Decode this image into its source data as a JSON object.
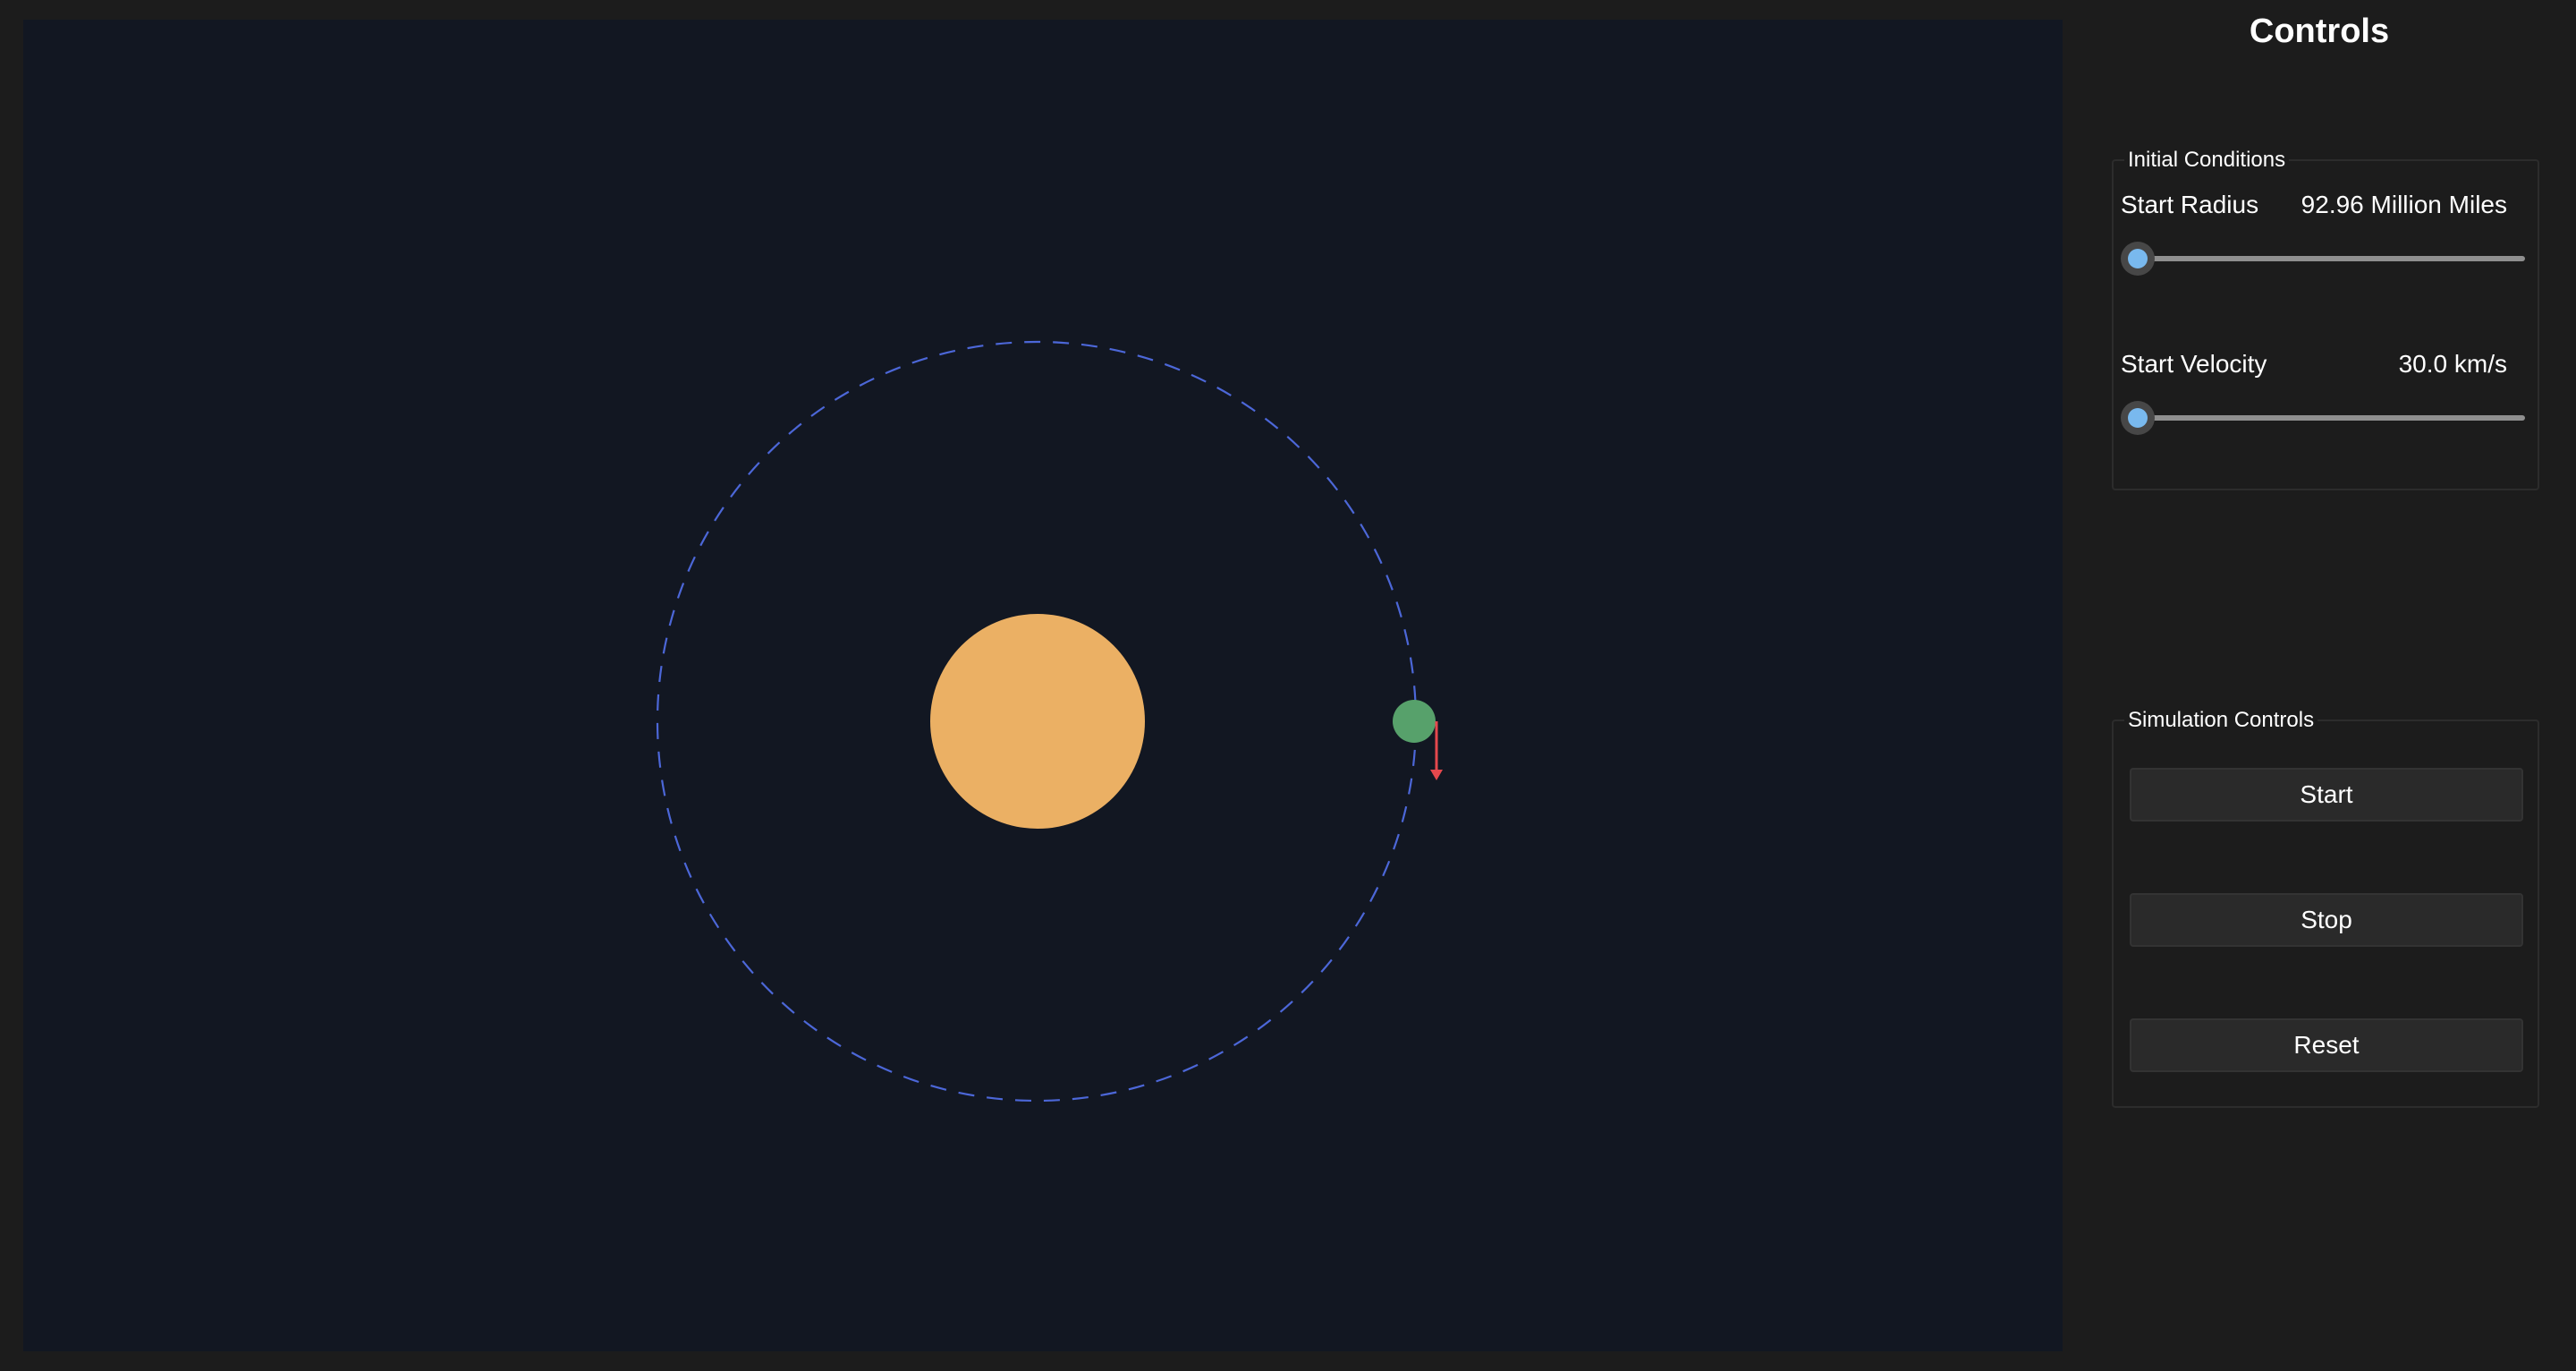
{
  "controls": {
    "title": "Controls",
    "initial_conditions": {
      "legend": "Initial Conditions",
      "start_radius": {
        "label": "Start Radius",
        "value_text": "92.96 Million Miles",
        "slider_fraction": 0.0
      },
      "start_velocity": {
        "label": "Start Velocity",
        "value_text": "30.0 km/s",
        "slider_fraction": 0.0
      }
    },
    "simulation_controls": {
      "legend": "Simulation Controls",
      "start_label": "Start",
      "stop_label": "Stop",
      "reset_label": "Reset"
    }
  },
  "scene": {
    "colors": {
      "background": "#121722",
      "sun": "#ebb064",
      "planet": "#57a16b",
      "orbit_path": "#4c67d8",
      "velocity_vector": "#e5484d"
    }
  }
}
